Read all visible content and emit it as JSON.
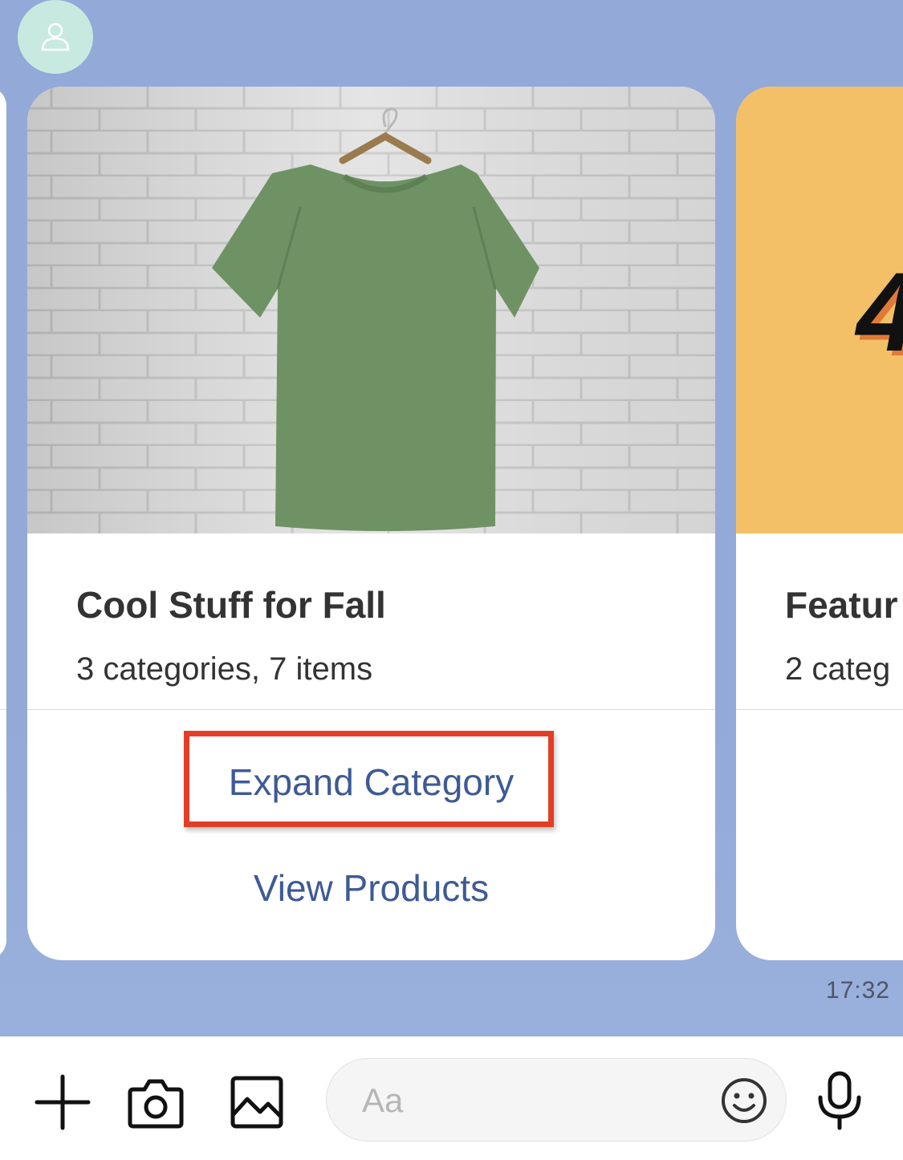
{
  "chat": {
    "cards": [
      {
        "title": "Cool Stuff for Fall",
        "subtitle": "3 categories, 7 items",
        "actions": [
          "Expand Category",
          "View Products"
        ],
        "image_icon": "green-tshirt-on-hanger"
      },
      {
        "badge": "4",
        "title": "Featur",
        "subtitle": "2 categ"
      }
    ],
    "timestamp": "17:32",
    "avatar_icon": "user-icon"
  },
  "composer": {
    "placeholder": "Aa",
    "icons": [
      "plus-icon",
      "camera-icon",
      "gallery-icon",
      "emoji-icon",
      "microphone-icon"
    ]
  },
  "colors": {
    "chat_background": "#93a9d8",
    "link": "#3e5a96",
    "highlight": "#e33e25",
    "next_card_image": "#f3c067",
    "avatar": "#c8e9e0"
  }
}
